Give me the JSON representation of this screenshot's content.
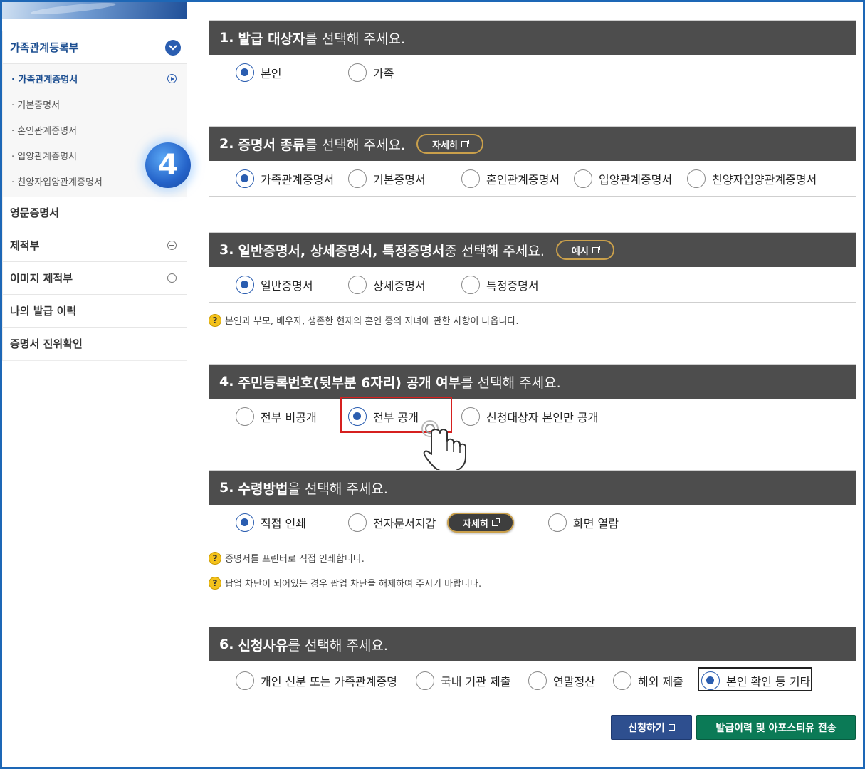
{
  "step_badge": "4",
  "sidebar": {
    "sections": [
      {
        "label": "가족관계등록부",
        "active": true
      },
      {
        "label": "영문증명서"
      },
      {
        "label": "제적부"
      },
      {
        "label": "이미지 제적부"
      },
      {
        "label": "나의 발급 이력"
      },
      {
        "label": "증명서 진위확인"
      }
    ],
    "subitems": [
      {
        "label": "· 가족관계증명서",
        "active": true
      },
      {
        "label": "· 기본증명서"
      },
      {
        "label": "· 혼인관계증명서"
      },
      {
        "label": "· 입양관계증명서"
      },
      {
        "label": "· 친양자입양관계증명서"
      }
    ]
  },
  "sections": [
    {
      "num": "1.",
      "bold": "발급 대상자",
      "rest": "를 선택해 주세요.",
      "options": [
        "본인",
        "가족"
      ],
      "selected": 0
    },
    {
      "num": "2.",
      "bold": "증명서 종류",
      "rest": "를 선택해 주세요.",
      "button": "자세히",
      "options": [
        "가족관계증명서",
        "기본증명서",
        "혼인관계증명서",
        "입양관계증명서",
        "친양자입양관계증명서"
      ],
      "selected": 0
    },
    {
      "num": "3.",
      "bold": "일반증명서, 상세증명서, 특정증명서",
      "rest": " 중 선택해 주세요.",
      "button": "예시",
      "options": [
        "일반증명서",
        "상세증명서",
        "특정증명서"
      ],
      "selected": 0,
      "help": "본인과 부모, 배우자, 생존한 현재의 혼인 중의 자녀에 관한 사항이 나옵니다."
    },
    {
      "num": "4.",
      "bold": "주민등록번호(뒷부분 6자리) 공개 여부",
      "rest": "를 선택해 주세요.",
      "options": [
        "전부 비공개",
        "전부 공개",
        "신청대상자 본인만 공개"
      ],
      "selected": 1
    },
    {
      "num": "5.",
      "bold": "수령방법",
      "rest": "을 선택해 주세요.",
      "button": "자세히",
      "options": [
        "직접 인쇄",
        "전자문서지갑",
        "화면 열람"
      ],
      "selected": 0,
      "help": [
        "증명서를 프린터로 직접 인쇄합니다.",
        "팝업 차단이 되어있는 경우 팝업 차단을 해제하여 주시기 바랍니다."
      ]
    },
    {
      "num": "6.",
      "bold": "신청사유",
      "rest": "를 선택해 주세요.",
      "options": [
        "개인 신분 또는 가족관계증명",
        "국내 기관 제출",
        "연말정산",
        "해외 제출",
        "본인 확인 등 기타"
      ],
      "selected": 4
    }
  ],
  "help_icon": "?",
  "buttons": {
    "apply": "신청하기",
    "send": "발급이력 및 아포스티유 전송"
  },
  "colors": {
    "header": "#4d4d4d",
    "accent": "#2a5db0",
    "apply": "#2e4f8f",
    "send": "#0b7a56",
    "highlight": "#d6201f"
  }
}
